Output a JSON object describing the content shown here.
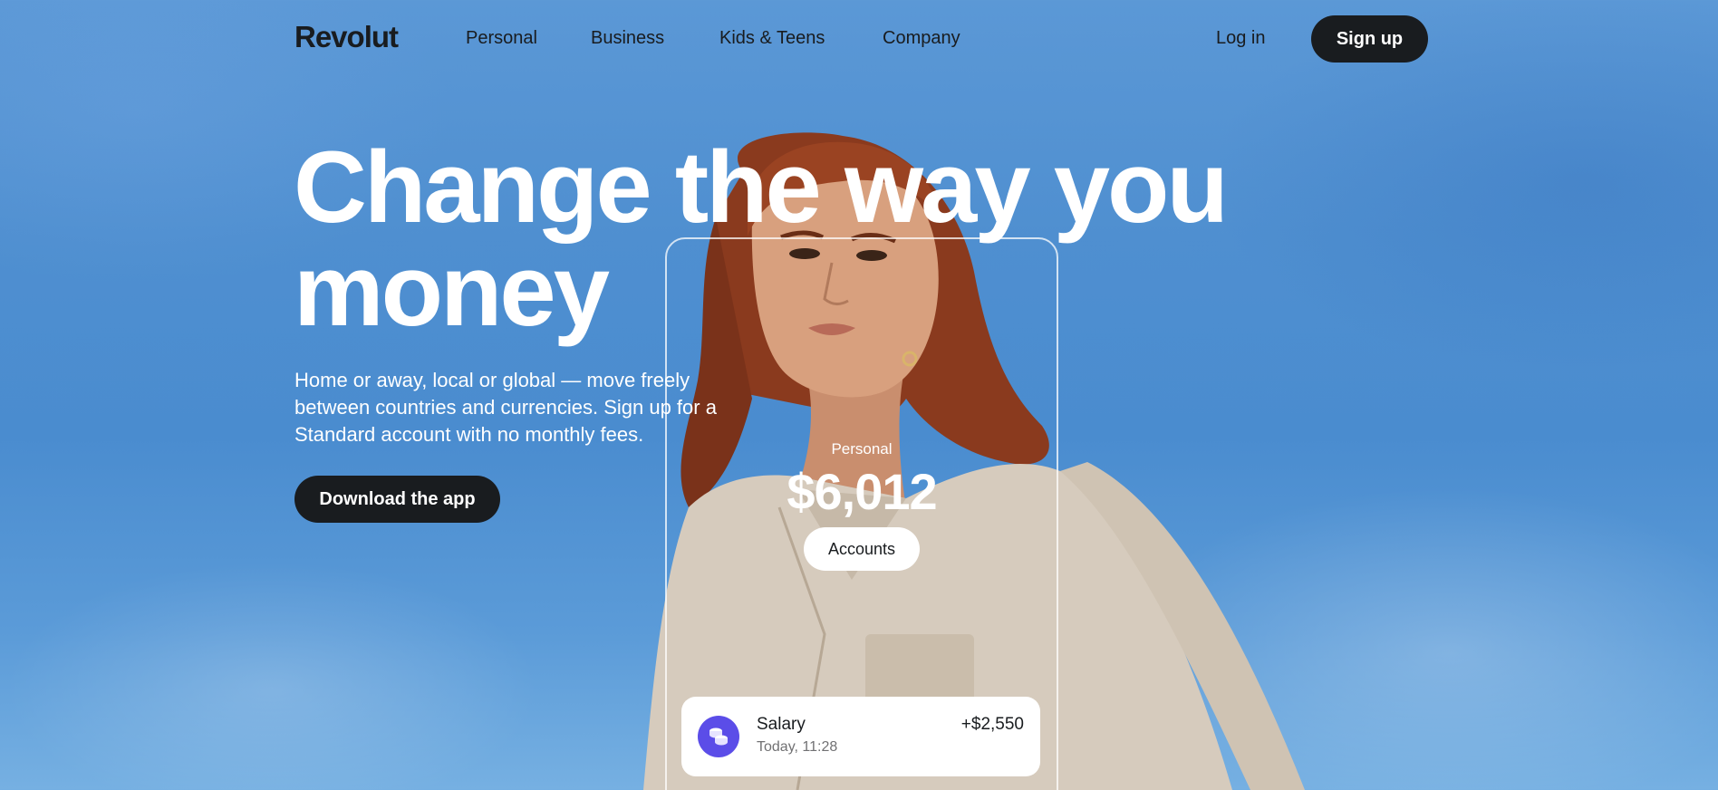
{
  "nav": {
    "logo": "Revolut",
    "links": [
      "Personal",
      "Business",
      "Kids & Teens",
      "Company"
    ],
    "login": "Log in",
    "signup": "Sign up"
  },
  "hero": {
    "title_line1": "Change the way you",
    "title_line2": "money",
    "subtitle": "Home or away, local or global — move freely between countries and currencies. Sign up for a Standard account with no monthly fees.",
    "download_button": "Download the app"
  },
  "phone": {
    "account_label": "Personal",
    "balance": "$6,012",
    "accounts_button": "Accounts"
  },
  "transaction": {
    "icon": "coins-icon",
    "name": "Salary",
    "time": "Today, 11:28",
    "amount": "+$2,550"
  },
  "colors": {
    "dark": "#191c1f",
    "sky": "#4f8fd0",
    "accent": "#5b4de8"
  }
}
